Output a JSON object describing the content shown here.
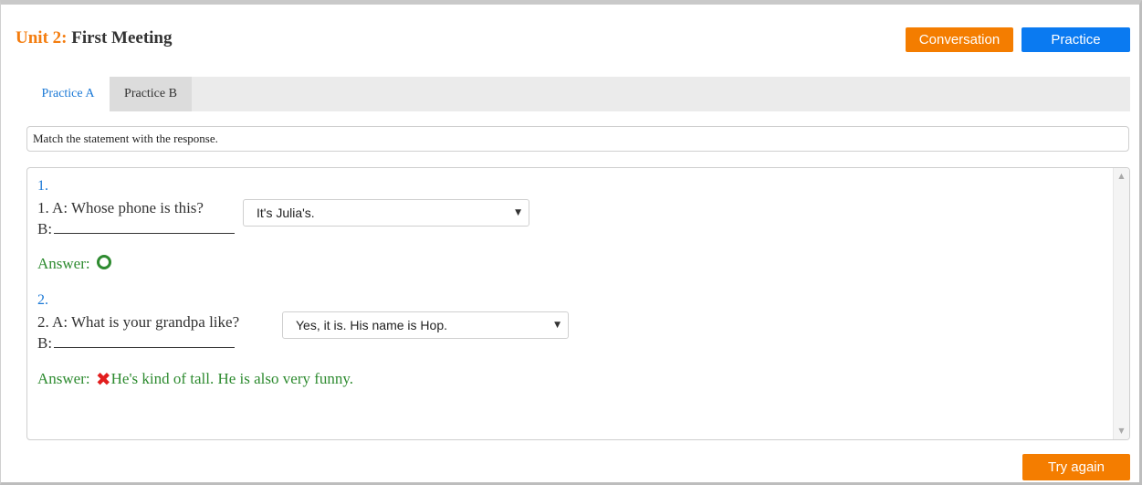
{
  "header": {
    "unit_label": "Unit 2:",
    "title": "First Meeting",
    "conversation_button": "Conversation",
    "practice_button": "Practice"
  },
  "tabs": [
    {
      "label": "Practice A",
      "active": true
    },
    {
      "label": "Practice B",
      "active": false
    }
  ],
  "instruction": "Match the statement with the response.",
  "questions": [
    {
      "number": "1.",
      "prompt": "1. A: Whose phone is this?",
      "b_label": "B:",
      "selected": "It's Julia's.",
      "answer_label": "Answer:",
      "result_icon": "correct-circle",
      "correct_answer": ""
    },
    {
      "number": "2.",
      "prompt": "2. A: What is your grandpa like?",
      "b_label": "B:",
      "selected": "Yes, it is. His name is Hop.",
      "answer_label": "Answer:",
      "result_icon": "incorrect-x",
      "correct_answer": "He's kind of tall. He is also very funny."
    }
  ],
  "footer": {
    "try_again_button": "Try again"
  },
  "colors": {
    "accent_orange": "#f47d00",
    "accent_blue": "#0a7af1",
    "answer_green": "#2e8b30",
    "wrong_red": "#e21d1d"
  }
}
